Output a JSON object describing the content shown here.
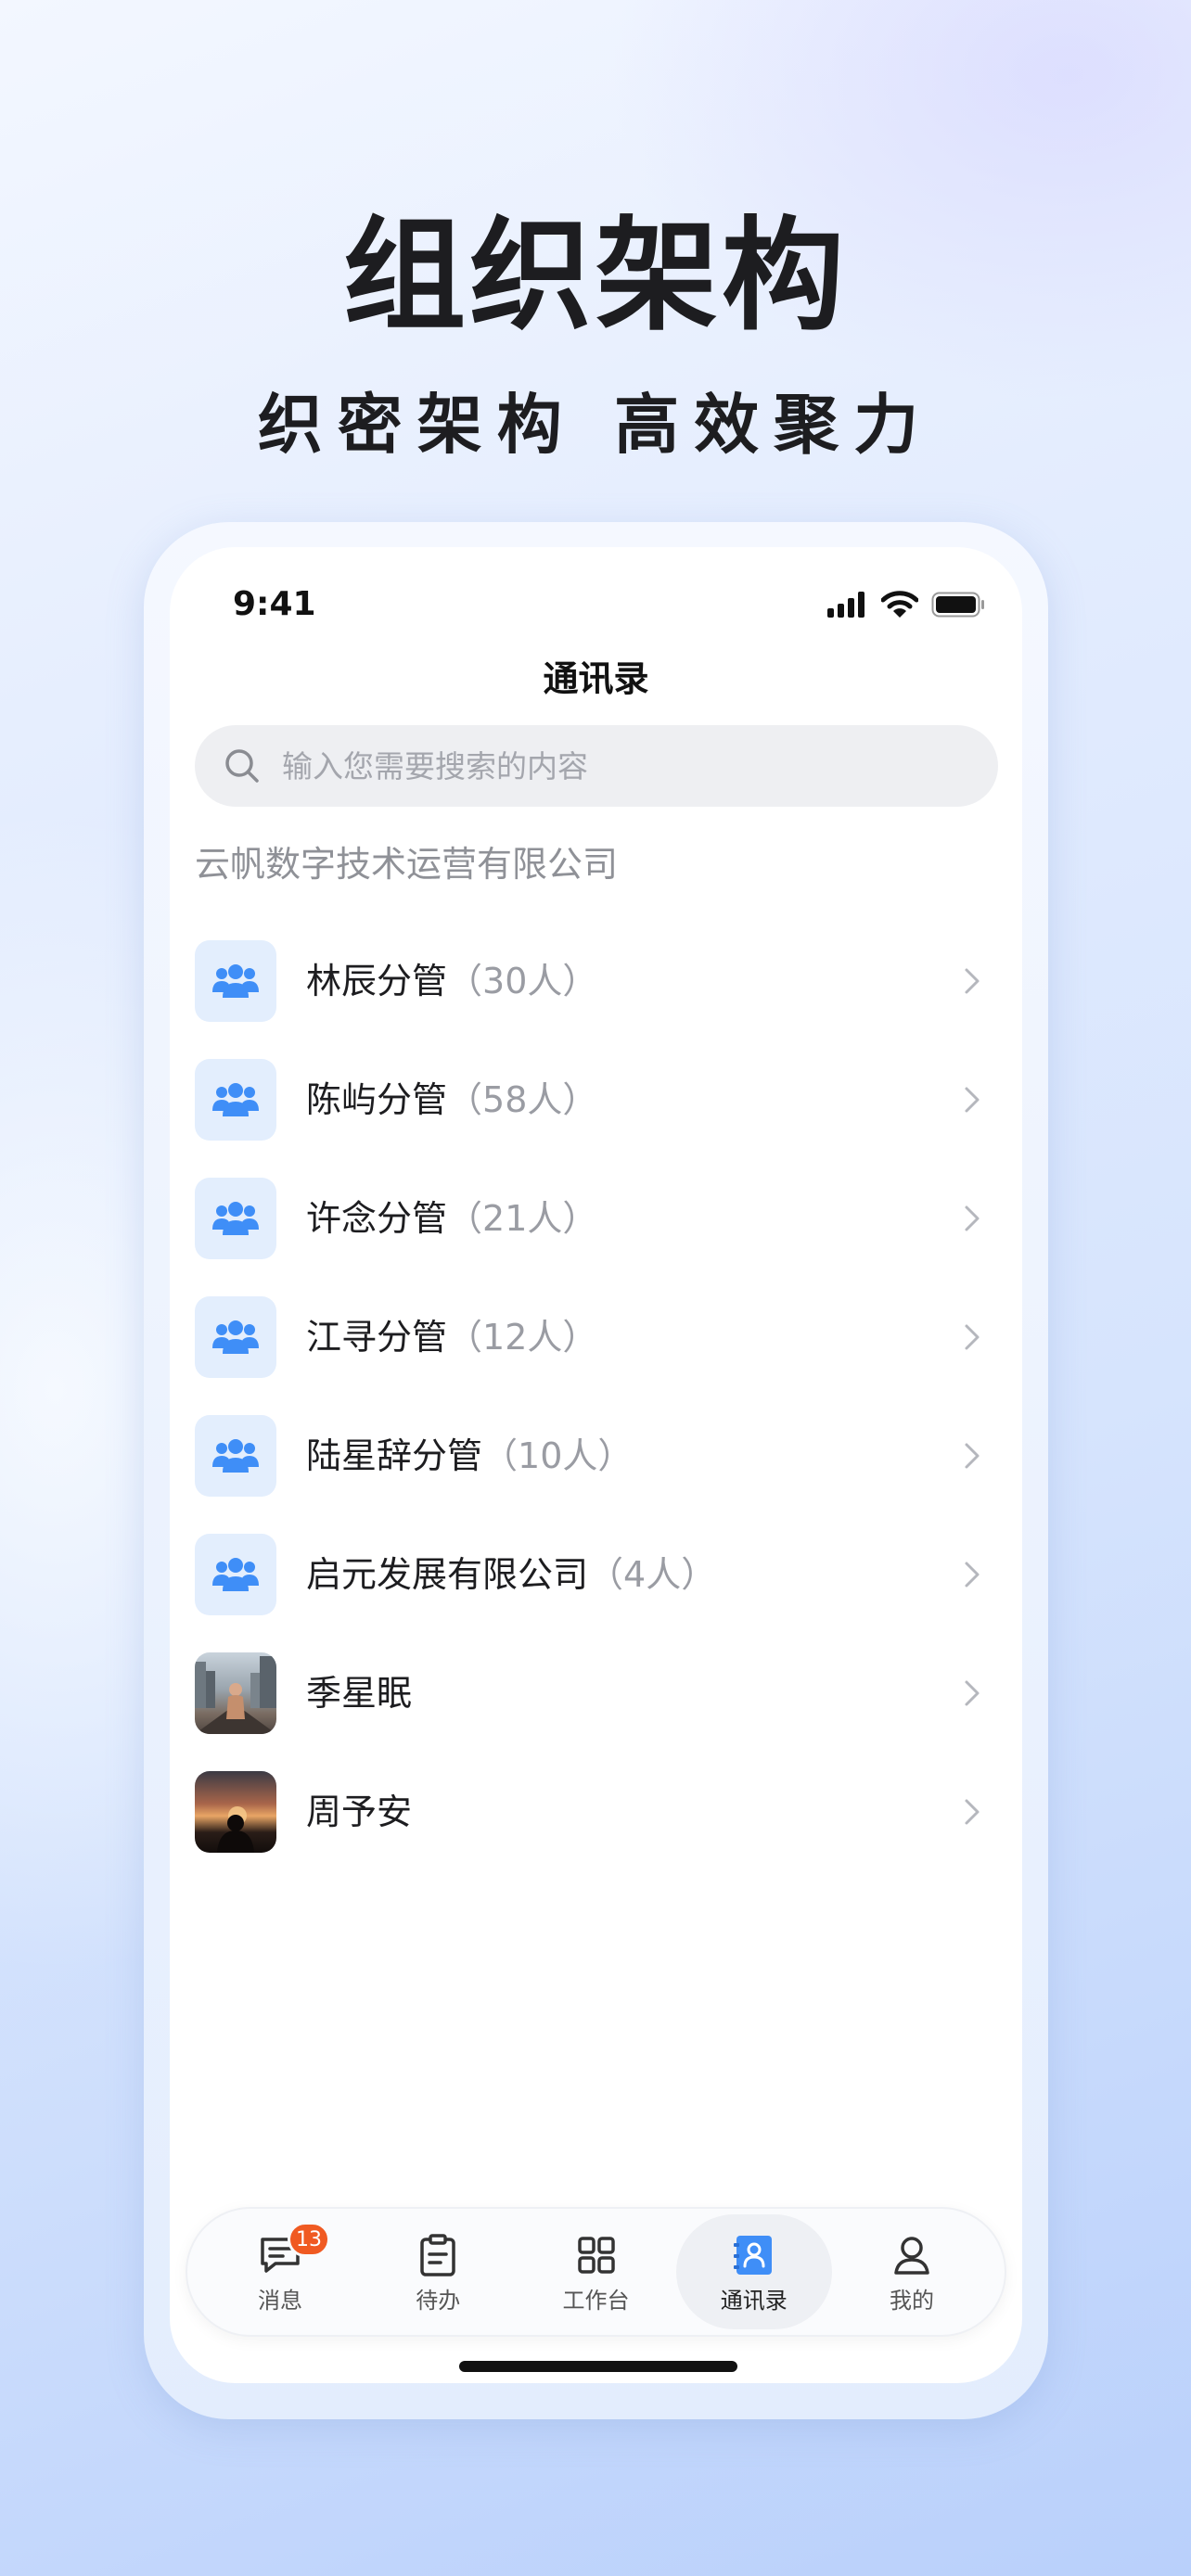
{
  "hero": {
    "title": "组织架构",
    "subtitle": "织密架构 高效聚力"
  },
  "status_bar": {
    "time": "9:41",
    "icons": [
      "signal-icon",
      "wifi-icon",
      "battery-icon"
    ]
  },
  "nav": {
    "title": "通讯录"
  },
  "search": {
    "placeholder": "输入您需要搜索的内容",
    "value": ""
  },
  "company": {
    "name": "云帆数字技术运营有限公司"
  },
  "contacts": [
    {
      "name": "林辰分管",
      "count": "（30人）",
      "icon": "group-icon"
    },
    {
      "name": "陈屿分管",
      "count": "（58人）",
      "icon": "group-icon"
    },
    {
      "name": "许念分管",
      "count": "（21人）",
      "icon": "group-icon"
    },
    {
      "name": "江寻分管",
      "count": "（12人）",
      "icon": "group-icon"
    },
    {
      "name": "陆星辞分管",
      "count": "（10人）",
      "icon": "group-icon"
    },
    {
      "name": "启元发展有限公司",
      "count": "（4人）",
      "icon": "group-icon"
    },
    {
      "name": "季星眠",
      "count": "",
      "icon": "user-photo"
    },
    {
      "name": "周予安",
      "count": "",
      "icon": "user-photo"
    }
  ],
  "tabbar": {
    "active": "通讯录",
    "tabs": [
      {
        "label": "消息",
        "icon": "message-icon",
        "badge": "13"
      },
      {
        "label": "待办",
        "icon": "clipboard-icon"
      },
      {
        "label": "工作台",
        "icon": "grid-icon"
      },
      {
        "label": "通讯录",
        "icon": "contacts-icon"
      },
      {
        "label": "我的",
        "icon": "profile-icon"
      }
    ]
  },
  "colors": {
    "accent": "#3f8ef7",
    "badge": "#f05a22",
    "avatar_bg": "#e3eefd"
  }
}
